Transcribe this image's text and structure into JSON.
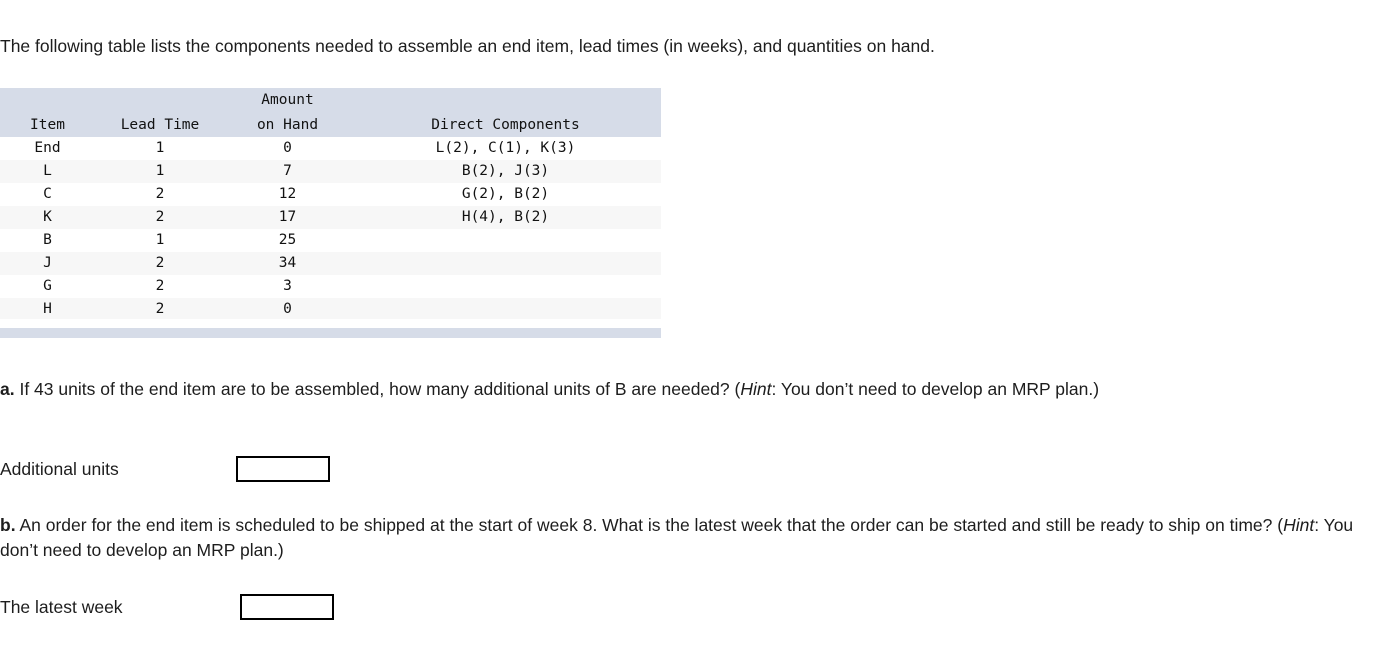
{
  "intro": {
    "text": "The following table lists the components needed to assemble an end item, lead times (in weeks), and quantities on hand."
  },
  "table": {
    "headers": {
      "item": "Item",
      "lead_time": "Lead Time",
      "amount_on_hand_line1": "Amount",
      "amount_on_hand_line2": "on Hand",
      "direct_components": "Direct Components"
    },
    "rows": [
      {
        "item": "End",
        "lead_time": "1",
        "amount_on_hand": "0",
        "direct_components": "L(2), C(1), K(3)"
      },
      {
        "item": "L",
        "lead_time": "1",
        "amount_on_hand": "7",
        "direct_components": "B(2), J(3)"
      },
      {
        "item": "C",
        "lead_time": "2",
        "amount_on_hand": "12",
        "direct_components": "G(2), B(2)"
      },
      {
        "item": "K",
        "lead_time": "2",
        "amount_on_hand": "17",
        "direct_components": "H(4), B(2)"
      },
      {
        "item": "B",
        "lead_time": "1",
        "amount_on_hand": "25",
        "direct_components": ""
      },
      {
        "item": "J",
        "lead_time": "2",
        "amount_on_hand": "34",
        "direct_components": ""
      },
      {
        "item": "G",
        "lead_time": "2",
        "amount_on_hand": "3",
        "direct_components": ""
      },
      {
        "item": "H",
        "lead_time": "2",
        "amount_on_hand": "0",
        "direct_components": ""
      }
    ]
  },
  "question_a": {
    "label": "a.",
    "text_before_hint": " If 43 units of the end item are to be assembled, how many additional units of B are needed? (",
    "hint_word": "Hint",
    "text_after_hint": ": You don’t need to develop an MRP plan.)",
    "answer_label": "Additional units",
    "answer_value": "",
    "answer_placeholder": ""
  },
  "question_b": {
    "label": "b.",
    "text_before_hint": " An order for the end item is scheduled to be shipped at the start of week 8. What is the latest week that the order can be started and still be ready to ship on time? (",
    "hint_word": "Hint",
    "text_after_hint": ": You don’t need to develop an MRP plan.)",
    "answer_label": "The latest week",
    "answer_value": "",
    "answer_placeholder": ""
  },
  "colors": {
    "table_header_bg": "#d6dce8",
    "table_row_alt_bg": "#f7f7f7",
    "text": "#1d1d1d",
    "input_border": "#000000"
  }
}
